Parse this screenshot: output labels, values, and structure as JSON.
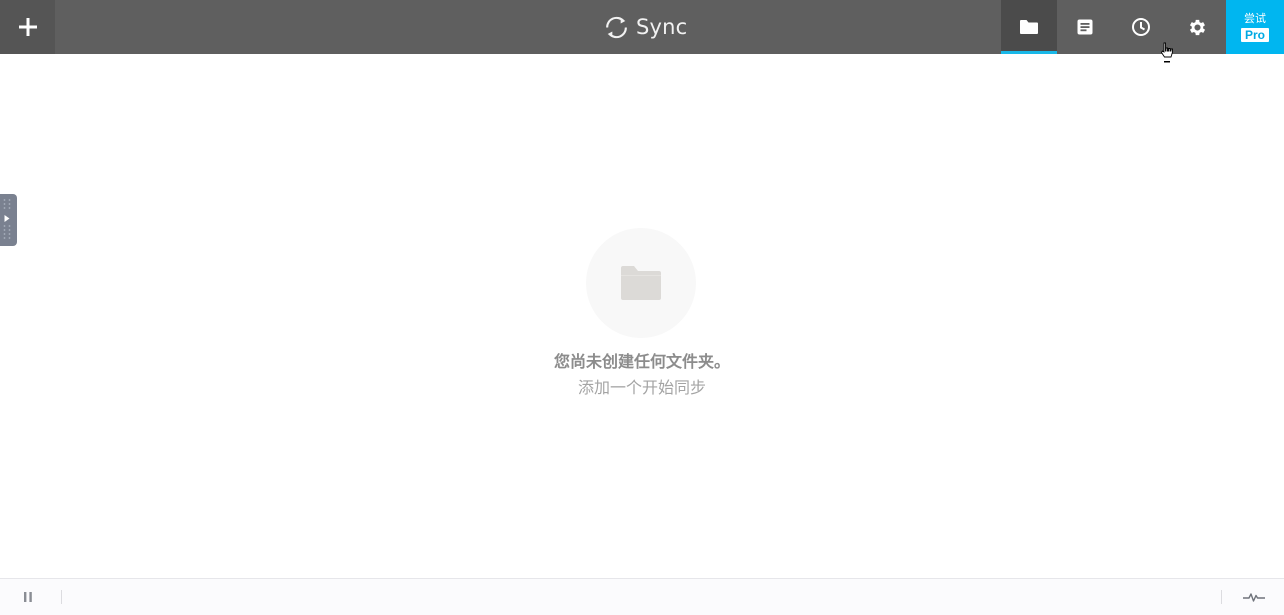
{
  "header": {
    "app_name": "Sync",
    "add_icon": "plus-icon",
    "logo_icon": "sync-logo-icon",
    "nav": [
      {
        "icon": "folder-icon",
        "active": true
      },
      {
        "icon": "document-icon",
        "active": false
      },
      {
        "icon": "clock-icon",
        "active": false
      },
      {
        "icon": "gear-icon",
        "active": false
      }
    ],
    "pro": {
      "top_label": "尝试",
      "badge_label": "Pro"
    }
  },
  "empty_state": {
    "icon": "folder-icon",
    "title": "您尚未创建任何文件夹。",
    "subtitle": "添加一个开始同步"
  },
  "statusbar": {
    "pause_icon": "pause-icon",
    "activity_icon": "activity-icon"
  },
  "colors": {
    "header_bg": "#5f5f5f",
    "accent": "#19b8e8",
    "pro_bg": "#00b6f0",
    "empty_text": "#8c8c8c"
  }
}
